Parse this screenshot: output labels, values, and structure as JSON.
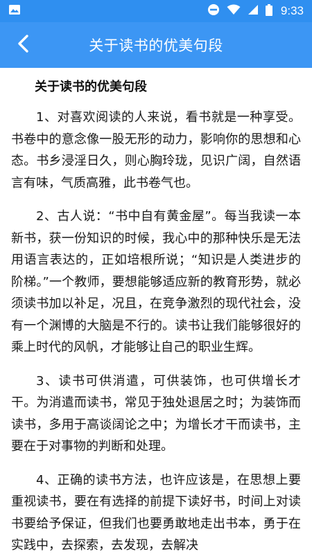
{
  "status_bar": {
    "time": "9:33",
    "icons": [
      "image-icon",
      "do-not-disturb-icon",
      "wifi-icon",
      "signal-icon",
      "battery-icon"
    ]
  },
  "app_bar": {
    "title": "关于读书的优美句段",
    "back_icon": "chevron-left-icon"
  },
  "article": {
    "title": "关于读书的优美句段",
    "paragraphs": [
      "1、对喜欢阅读的人来说，看书就是一种享受。书卷中的意念像一股无形的动力，影响你的思想和心态。书乡浸淫日久，则心胸玲珑，见识广阔，自然语言有味，气质高雅，此书卷气也。",
      "2、古人说：“书中自有黄金屋”。每当我读一本新书，获一份知识的时候，我心中的那种快乐是无法用语言表达的，正如培根所说；“知识是人类进步的阶梯。”一个教师，要想能够适应新的教育形势，就必须读书加以补足，况且，在竞争激烈的现代社会，没有一个渊博的大脑是不行的。读书让我们能够很好的乘上时代的风帆，才能够让自己的职业生辉。",
      "3、读书可供消遣，可供装饰，也可供增长才干。为消遣而读书，常见于独处退居之时；为装饰而读书，多用于高谈阔论之中；为增长才干而读书，主要在于对事物的判断和处理。",
      "4、正确的读书方法，也许应该是，在思想上要重视读书，要在有选择的前提下读好书，时间上对读书要给予保证，但我们也要勇敢地走出书本，勇于在实践中，去探索，去发现，去解决"
    ]
  },
  "colors": {
    "status_bar": "#2f8ff0",
    "app_bar": "#3c96f4",
    "text": "#1a1a1a"
  }
}
